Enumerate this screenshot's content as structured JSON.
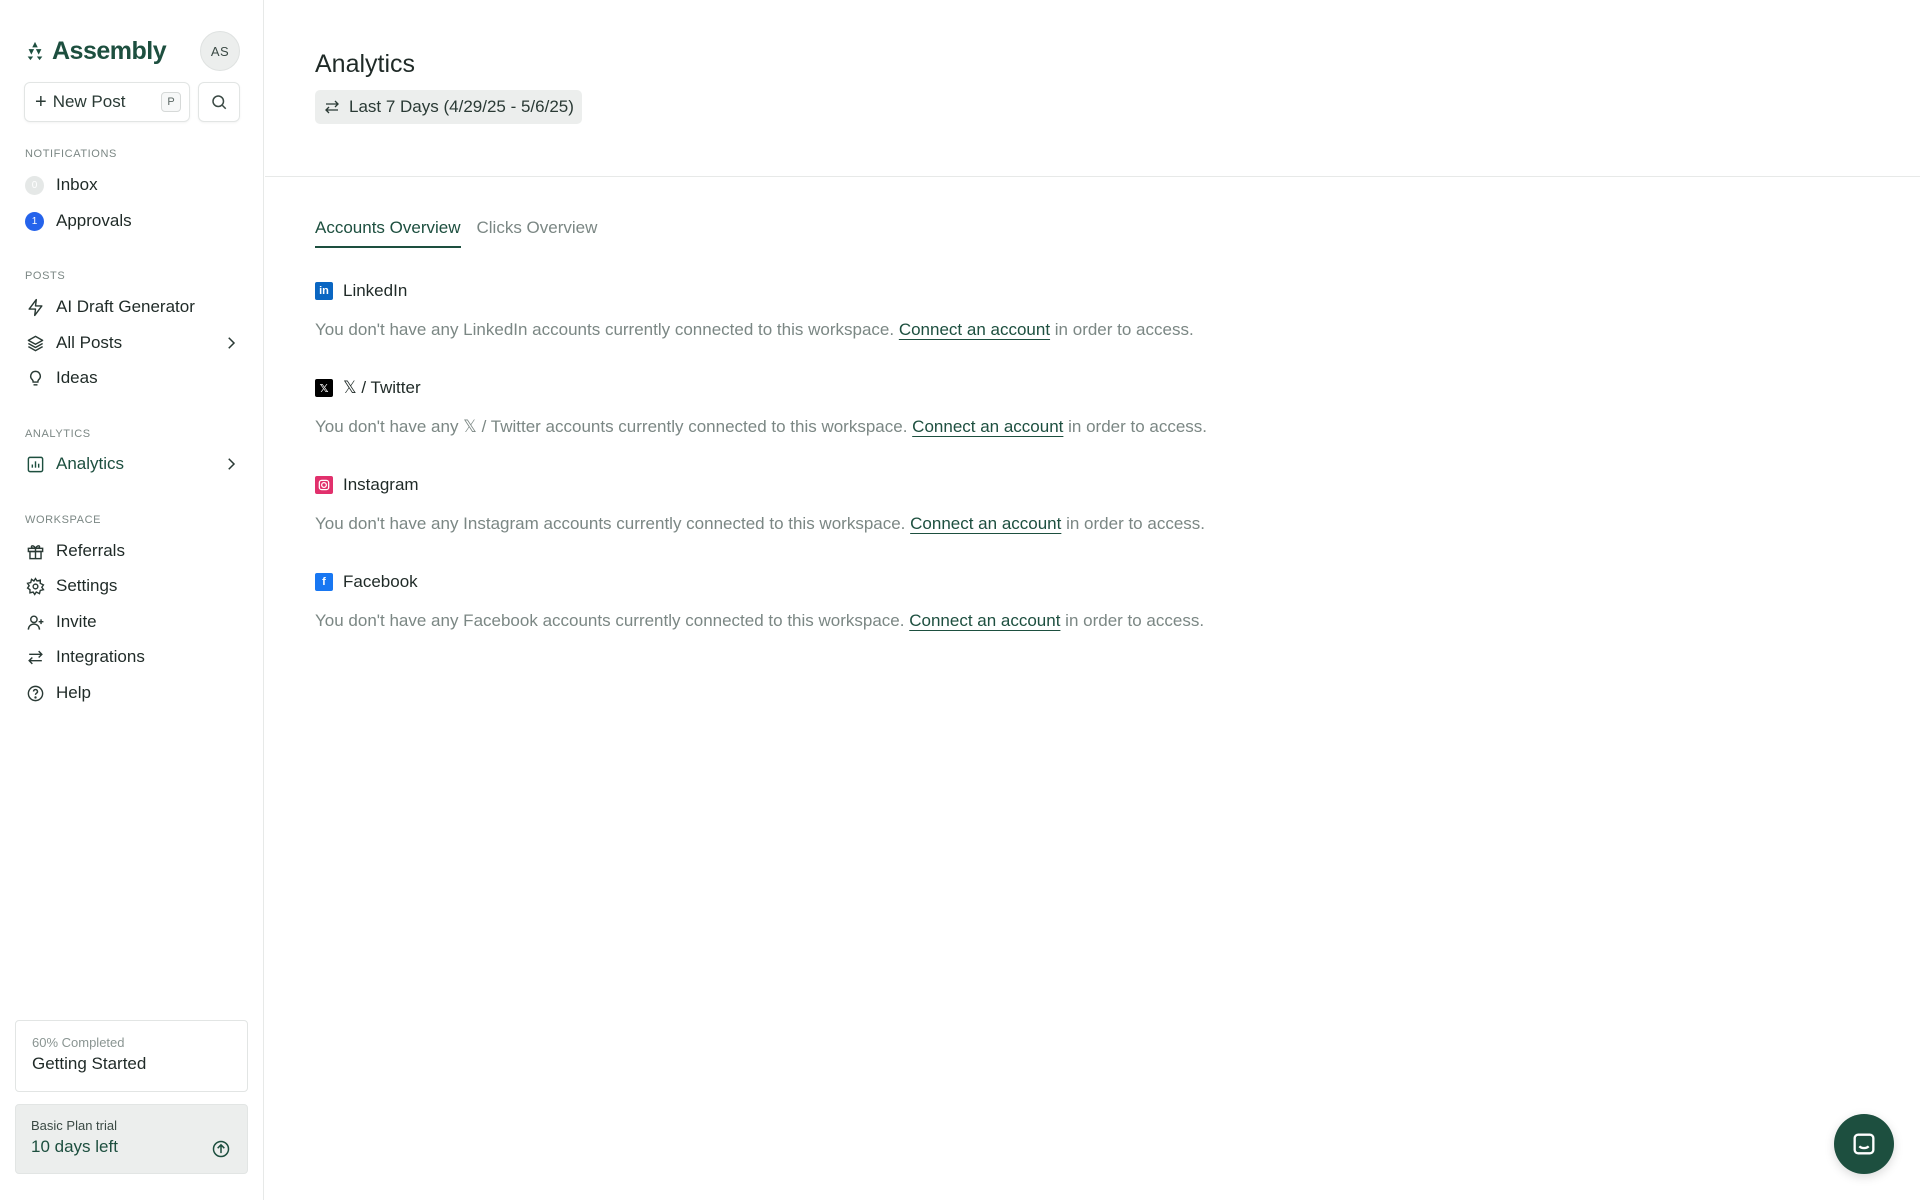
{
  "brand": {
    "name": "Assembly",
    "avatar_initials": "AS",
    "accent_color": "#1d4f3f"
  },
  "toolbar": {
    "new_post_label": "New Post",
    "new_post_shortcut": "P",
    "search_icon": "search-icon"
  },
  "sidebar": {
    "notifications_label": "NOTIFICATIONS",
    "inbox": {
      "label": "Inbox",
      "count": "0"
    },
    "approvals": {
      "label": "Approvals",
      "count": "1"
    },
    "posts_label": "POSTS",
    "ai_draft": "AI Draft Generator",
    "all_posts": "All Posts",
    "ideas": "Ideas",
    "analytics_label": "ANALYTICS",
    "analytics": "Analytics",
    "workspace_label": "WORKSPACE",
    "referrals": "Referrals",
    "settings": "Settings",
    "invite": "Invite",
    "integrations": "Integrations",
    "help": "Help"
  },
  "progress": {
    "percent_text": "60% Completed",
    "percent": 60,
    "title": "Getting Started"
  },
  "trial": {
    "plan": "Basic Plan trial",
    "remaining": "10 days left"
  },
  "main": {
    "title": "Analytics",
    "date_range": "Last 7 Days (4/29/25 - 5/6/25)",
    "tabs": [
      {
        "label": "Accounts Overview",
        "active": true
      },
      {
        "label": "Clicks Overview",
        "active": false
      }
    ],
    "accounts": [
      {
        "name": "LinkedIn",
        "icon": "linkedin-icon",
        "color": "#0a66c2",
        "msg_before": "You don't have any LinkedIn accounts currently connected to this workspace.",
        "link": "Connect an account",
        "msg_after": "in order to access."
      },
      {
        "name": "𝕏 / Twitter",
        "icon": "x-twitter-icon",
        "color": "#000000",
        "msg_before": "You don't have any 𝕏 / Twitter accounts currently connected to this workspace.",
        "link": "Connect an account",
        "msg_after": "in order to access."
      },
      {
        "name": "Instagram",
        "icon": "instagram-icon",
        "color": "#e1306c",
        "msg_before": "You don't have any Instagram accounts currently connected to this workspace.",
        "link": "Connect an account",
        "msg_after": "in order to access."
      },
      {
        "name": "Facebook",
        "icon": "facebook-icon",
        "color": "#1877f2",
        "msg_before": "You don't have any Facebook accounts currently connected to this workspace.",
        "link": "Connect an account",
        "msg_after": "in order to access."
      }
    ]
  }
}
